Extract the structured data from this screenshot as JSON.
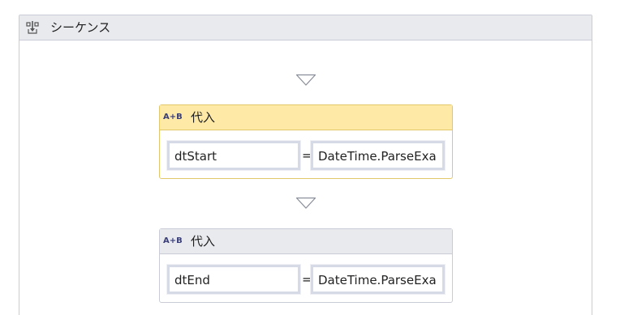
{
  "sequence": {
    "title": "シーケンス",
    "icon": "sequence-icon"
  },
  "activities": [
    {
      "icon_text": "A+B",
      "title": "代入",
      "to_value": "dtStart",
      "equals": "=",
      "value_expression": "DateTime.ParseExa",
      "selected": true
    },
    {
      "icon_text": "A+B",
      "title": "代入",
      "to_value": "dtEnd",
      "equals": "=",
      "value_expression": "DateTime.ParseExa",
      "selected": false
    }
  ],
  "colors": {
    "selected_header": "#ffe9a6",
    "selected_border": "#e3c86a",
    "header_gray": "#e9eaee",
    "border_gray": "#c9ccd6",
    "field_border": "#d6d9e6",
    "icon_blue": "#3a3f7a"
  }
}
